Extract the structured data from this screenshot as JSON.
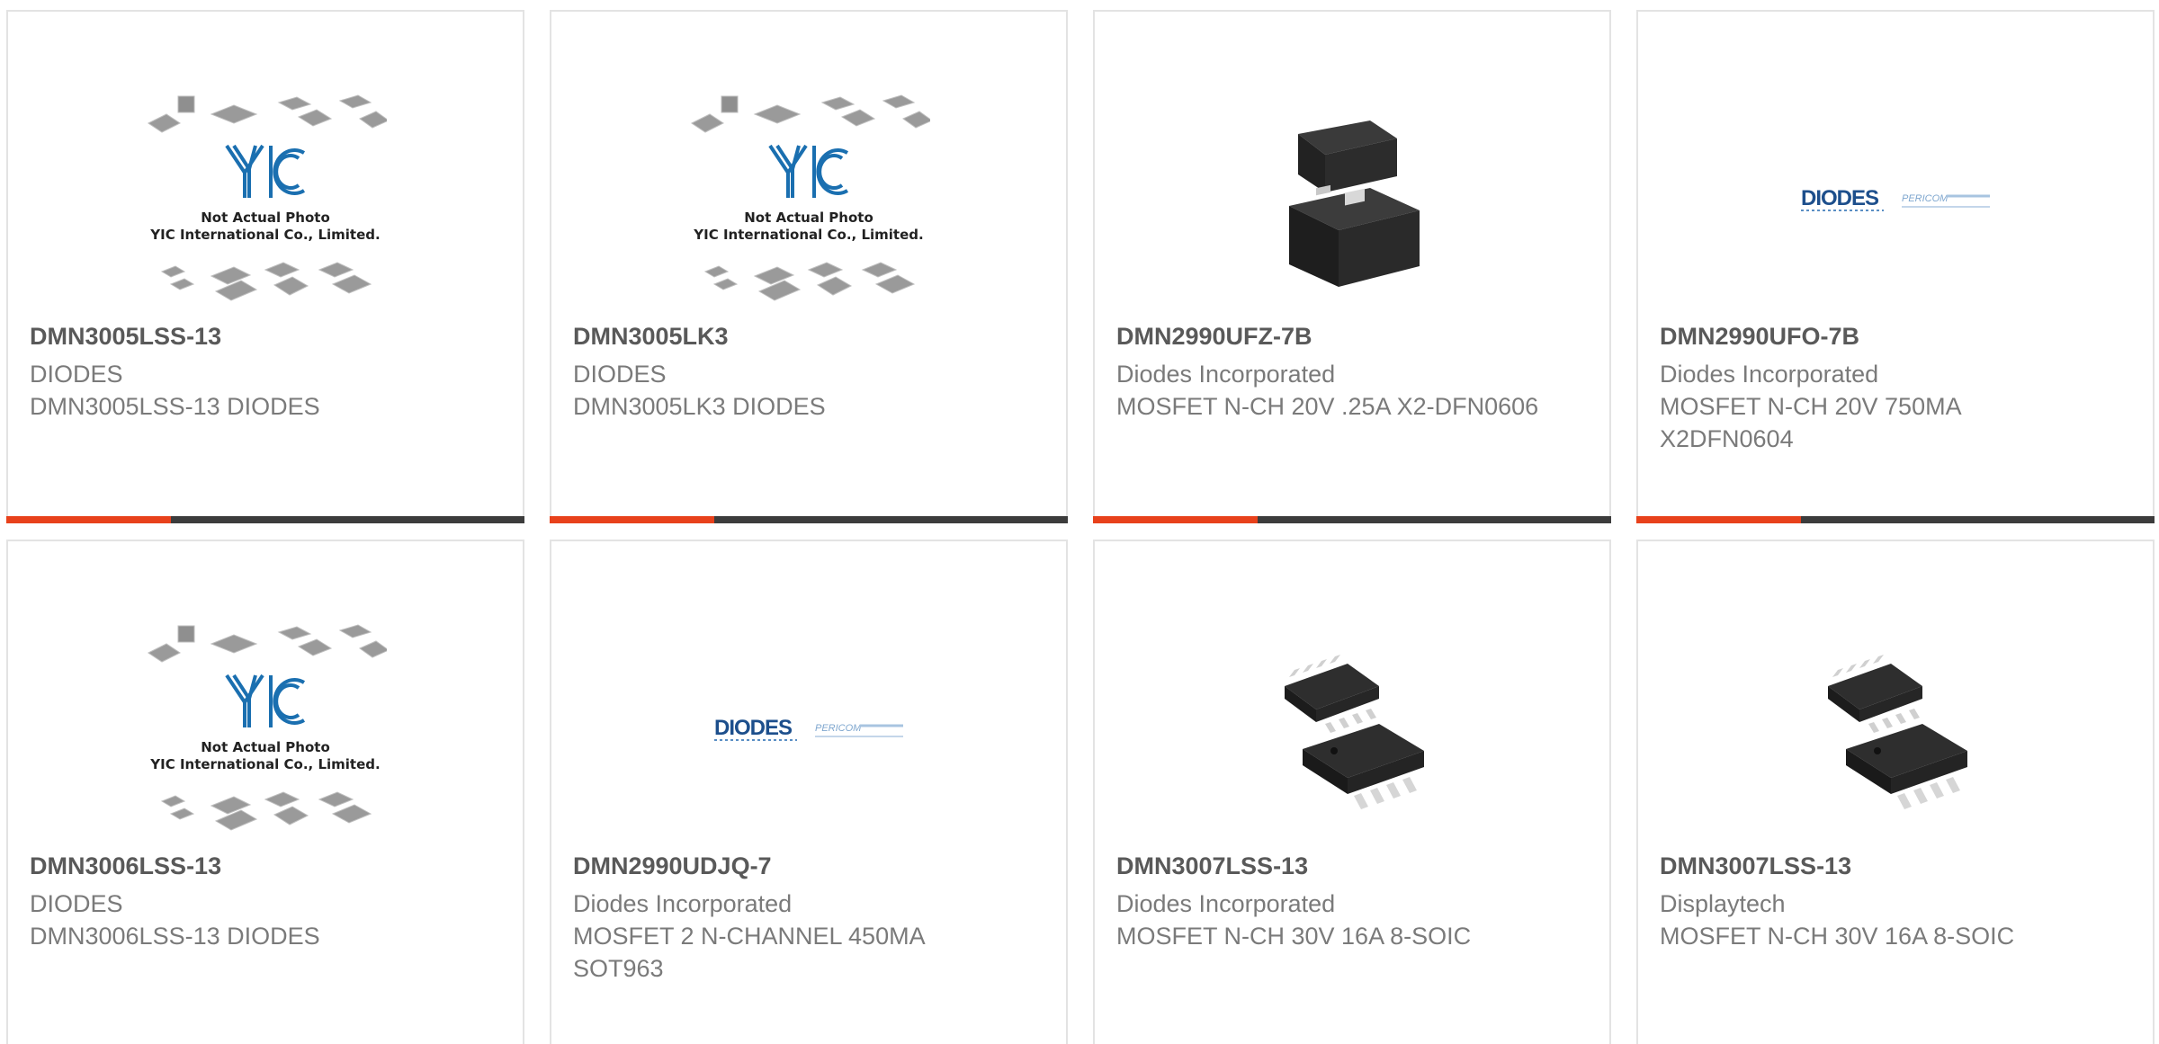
{
  "products": [
    {
      "part_number": "DMN3005LSS-13",
      "manufacturer": "DIODES",
      "description": "DMN3005LSS-13 DIODES",
      "image": "yic-placeholder",
      "image_caption_1": "Not Actual Photo",
      "image_caption_2": "YIC International Co., Limited."
    },
    {
      "part_number": "DMN3005LK3",
      "manufacturer": "DIODES",
      "description": "DMN3005LK3 DIODES",
      "image": "yic-placeholder",
      "image_caption_1": "Not Actual Photo",
      "image_caption_2": "YIC International Co., Limited."
    },
    {
      "part_number": "DMN2990UFZ-7B",
      "manufacturer": "Diodes Incorporated",
      "description": "MOSFET N-CH 20V .25A X2-DFN0606",
      "image": "dfn-package"
    },
    {
      "part_number": "DMN2990UFO-7B",
      "manufacturer": "Diodes Incorporated",
      "description": "MOSFET N-CH 20V 750MA X2DFN0604",
      "image": "diodes-logo",
      "logo_text": "DIODES",
      "logo_secondary": "PERICOM"
    },
    {
      "part_number": "DMN3006LSS-13",
      "manufacturer": "DIODES",
      "description": "DMN3006LSS-13 DIODES",
      "image": "yic-placeholder",
      "image_caption_1": "Not Actual Photo",
      "image_caption_2": "YIC International Co., Limited."
    },
    {
      "part_number": "DMN2990UDJQ-7",
      "manufacturer": "Diodes Incorporated",
      "description": "MOSFET 2 N-CHANNEL 450MA SOT963",
      "image": "diodes-logo",
      "logo_text": "DIODES",
      "logo_secondary": "PERICOM"
    },
    {
      "part_number": "DMN3007LSS-13",
      "manufacturer": "Diodes Incorporated",
      "description": "MOSFET N-CH 30V 16A 8-SOIC",
      "image": "soic8-package"
    },
    {
      "part_number": "DMN3007LSS-13",
      "manufacturer": "Displaytech",
      "description": "MOSFET N-CH 30V 16A 8-SOIC",
      "image": "soic8-package"
    }
  ],
  "colors": {
    "accent": "#e8411b",
    "bar": "#3c3c3c",
    "part_number": "#595959",
    "text": "#7a7a7a",
    "yic_blue": "#1a6fb0",
    "diodes_blue": "#1d4f8c"
  }
}
